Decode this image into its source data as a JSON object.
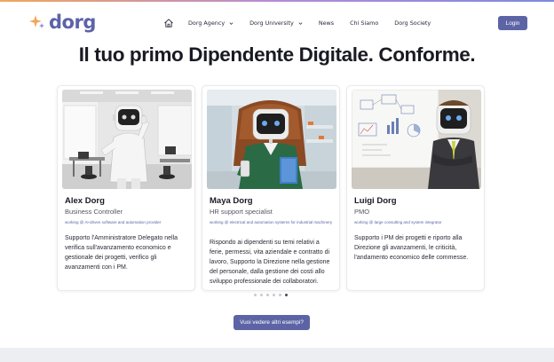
{
  "brand": {
    "name": "dorg",
    "accent": "#5c64a6"
  },
  "nav": {
    "home_icon": "home-icon",
    "items": [
      {
        "label": "Dorg Agency",
        "dropdown": true
      },
      {
        "label": "Dorg University",
        "dropdown": true
      },
      {
        "label": "News",
        "dropdown": false
      },
      {
        "label": "Chi Siamo",
        "dropdown": false
      },
      {
        "label": "Dorg Society",
        "dropdown": false
      }
    ],
    "login_label": "Login"
  },
  "hero": {
    "title": "Il tuo primo Dipendente Digitale. Conforme."
  },
  "cards": [
    {
      "name": "Alex Dorg",
      "role": "Business Controller",
      "company": "working @ AI-driven software and automation provider",
      "description": "Supporto l'Amministratore Delegato nella verifica sull'avanzamento economico e gestionale dei progetti, verifico gli avanzamenti con i PM."
    },
    {
      "name": "Maya Dorg",
      "role": "HR support specialist",
      "company": "working @ electrical and automation systems for industrial machinery",
      "description": "Rispondo ai dipendenti su temi relativi a ferie, permessi, vita aziendale e contratto di lavoro, Supporto la Direzione nella gestione del personale, dalla gestione dei costi allo sviluppo professionale dei collaboratori."
    },
    {
      "name": "Luigi Dorg",
      "role": "PMO",
      "company": "working @ large consulting and system integrator",
      "description": "Supporto i PM dei progetti e riporto alla Direzione gli avanzamenti, le criticità, l'andamento economico delle commesse."
    }
  ],
  "carousel": {
    "total": 6,
    "active_index": 5
  },
  "more_button_label": "Vuoi vedere altri esempi?"
}
